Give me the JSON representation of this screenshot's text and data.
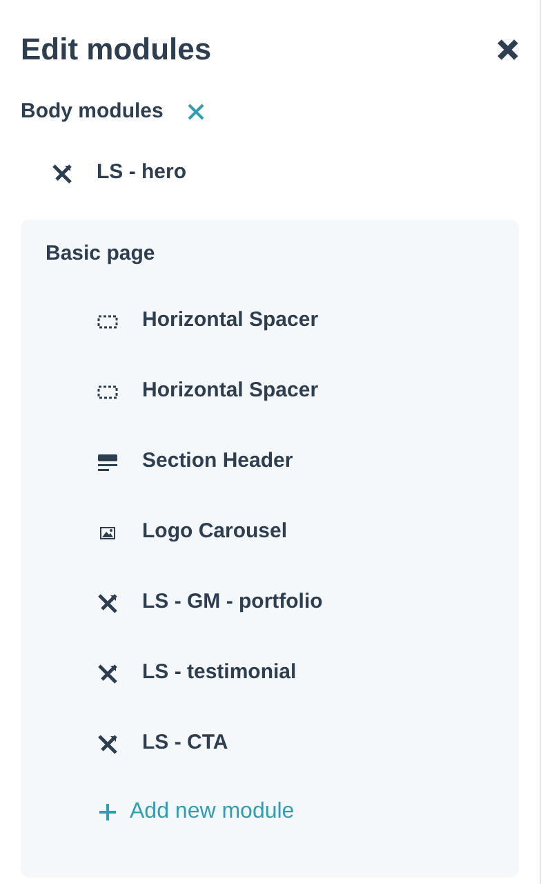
{
  "title": "Edit modules",
  "section": {
    "label": "Body modules"
  },
  "top_modules": [
    {
      "kind": "tools",
      "label": "LS - hero"
    }
  ],
  "group": {
    "title": "Basic page",
    "modules": [
      {
        "kind": "spacer",
        "label": "Horizontal Spacer"
      },
      {
        "kind": "spacer",
        "label": "Horizontal Spacer"
      },
      {
        "kind": "header",
        "label": "Section Header"
      },
      {
        "kind": "image",
        "label": "Logo Carousel"
      },
      {
        "kind": "tools",
        "label": "LS - GM - portfolio"
      },
      {
        "kind": "tools",
        "label": "LS - testimonial"
      },
      {
        "kind": "tools",
        "label": "LS - CTA"
      }
    ],
    "add_label": "Add new module"
  }
}
